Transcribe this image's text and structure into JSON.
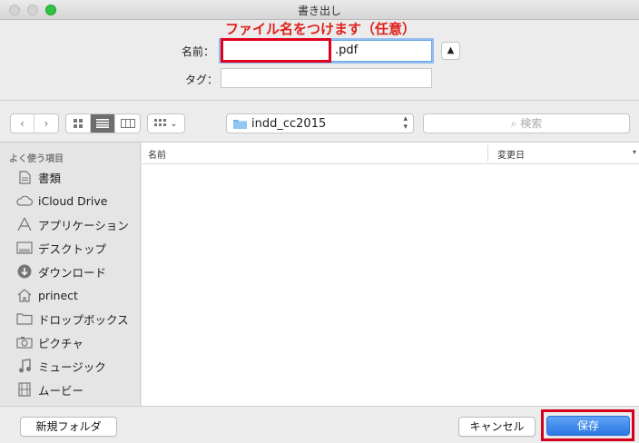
{
  "window": {
    "title": "書き出し"
  },
  "annotation": "ファイル名をつけます（任意）",
  "form": {
    "name_label": "名前：",
    "name_value": "",
    "name_extension": ".pdf",
    "tag_label": "タグ：",
    "tag_value": ""
  },
  "toolbar": {
    "back_icon": "chevron-left-icon",
    "forward_icon": "chevron-right-icon",
    "view_modes": [
      "icon-view-icon",
      "list-view-icon",
      "column-view-icon"
    ],
    "active_view": "list",
    "location": "indd_cc2015",
    "search_placeholder": "検索"
  },
  "sidebar": {
    "section_label": "よく使う項目",
    "items": [
      {
        "label": "書類",
        "icon": "documents-icon"
      },
      {
        "label": "iCloud Drive",
        "icon": "cloud-icon"
      },
      {
        "label": "アプリケーション",
        "icon": "applications-icon"
      },
      {
        "label": "デスクトップ",
        "icon": "desktop-icon"
      },
      {
        "label": "ダウンロード",
        "icon": "download-icon"
      },
      {
        "label": "prinect",
        "icon": "home-icon"
      },
      {
        "label": "ドロップボックス",
        "icon": "folder-icon"
      },
      {
        "label": "ピクチャ",
        "icon": "camera-icon"
      },
      {
        "label": "ミュージック",
        "icon": "music-icon"
      },
      {
        "label": "ムービー",
        "icon": "film-icon"
      }
    ]
  },
  "filelist": {
    "columns": [
      "名前",
      "変更日"
    ]
  },
  "buttons": {
    "new_folder": "新規フォルダ",
    "cancel": "キャンセル",
    "save": "保存"
  },
  "colors": {
    "accent": "#2a78e4",
    "highlight_red": "#e0001b"
  }
}
